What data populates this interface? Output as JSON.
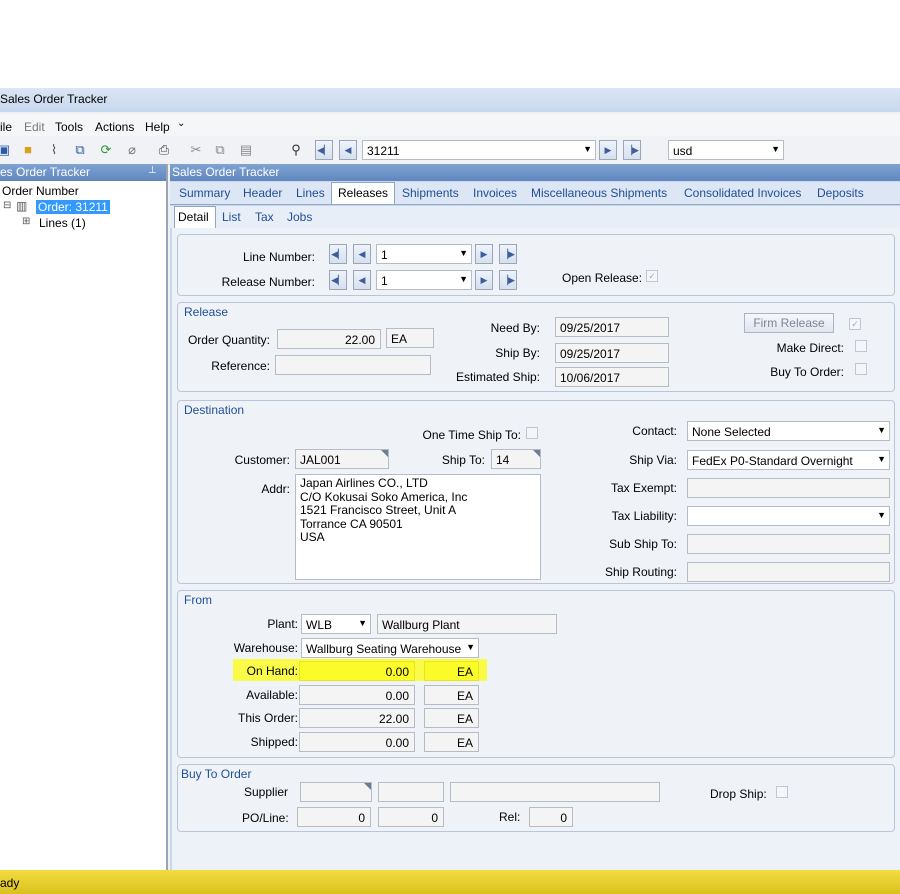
{
  "window": {
    "title": "Sales Order Tracker"
  },
  "menu": {
    "file": "ile",
    "edit": "Edit",
    "tools": "Tools",
    "actions": "Actions",
    "help": "Help"
  },
  "toolbar": {
    "order_value": "31211",
    "currency_value": "usd"
  },
  "left_panel": {
    "header": "es Order Tracker",
    "root": "Order Number",
    "order_node": "Order: 31211",
    "lines_node": "Lines (1)"
  },
  "right_panel": {
    "header": "Sales Order Tracker",
    "tabs": [
      "Summary",
      "Header",
      "Lines",
      "Releases",
      "Shipments",
      "Invoices",
      "Miscellaneous Shipments",
      "Consolidated Invoices",
      "Deposits"
    ],
    "subtabs": [
      "Detail",
      "List",
      "Tax",
      "Jobs"
    ]
  },
  "nav": {
    "line_number_label": "Line Number:",
    "line_number_value": "1",
    "release_number_label": "Release Number:",
    "release_number_value": "1",
    "open_release_label": "Open Release:"
  },
  "release": {
    "title": "Release",
    "order_qty_label": "Order Quantity:",
    "order_qty_value": "22.00",
    "order_qty_uom": "EA",
    "reference_label": "Reference:",
    "need_by_label": "Need By:",
    "need_by_value": "09/25/2017",
    "ship_by_label": "Ship By:",
    "ship_by_value": "09/25/2017",
    "est_ship_label": "Estimated Ship:",
    "est_ship_value": "10/06/2017",
    "firm_release_label": "Firm Release",
    "make_direct_label": "Make Direct:",
    "buy_to_order_label": "Buy To Order:"
  },
  "destination": {
    "title": "Destination",
    "one_time_label": "One Time Ship To:",
    "customer_label": "Customer:",
    "customer_value": "JAL001",
    "ship_to_label": "Ship To:",
    "ship_to_value": "14",
    "addr_label": "Addr:",
    "addr_lines": [
      "Japan Airlines CO., LTD",
      "C/O Kokusai Soko America, Inc",
      "1521 Francisco Street, Unit A",
      "Torrance CA 90501",
      "USA"
    ],
    "contact_label": "Contact:",
    "contact_value": "None Selected",
    "ship_via_label": "Ship Via:",
    "ship_via_value": "FedEx P0-Standard Overnight",
    "tax_exempt_label": "Tax Exempt:",
    "tax_liability_label": "Tax Liability:",
    "sub_ship_to_label": "Sub Ship To:",
    "ship_routing_label": "Ship Routing:"
  },
  "from": {
    "title": "From",
    "plant_label": "Plant:",
    "plant_code": "WLB",
    "plant_name": "Wallburg Plant",
    "warehouse_label": "Warehouse:",
    "warehouse_value": "Wallburg Seating Warehouse",
    "on_hand_label": "On Hand:",
    "on_hand_value": "0.00",
    "on_hand_uom": "EA",
    "available_label": "Available:",
    "available_value": "0.00",
    "available_uom": "EA",
    "this_order_label": "This Order:",
    "this_order_value": "22.00",
    "this_order_uom": "EA",
    "shipped_label": "Shipped:",
    "shipped_value": "0.00",
    "shipped_uom": "EA",
    "highlight_color": "#fbfb2a"
  },
  "buy_to_order": {
    "title": "Buy To Order",
    "supplier_label": "Supplier",
    "drop_ship_label": "Drop Ship:",
    "po_line_label": "PO/Line:",
    "po_value": "0",
    "line_value": "0",
    "rel_label": "Rel:",
    "rel_value": "0"
  },
  "status": {
    "text": "ady",
    "bar_color": "#e8cf2e"
  }
}
